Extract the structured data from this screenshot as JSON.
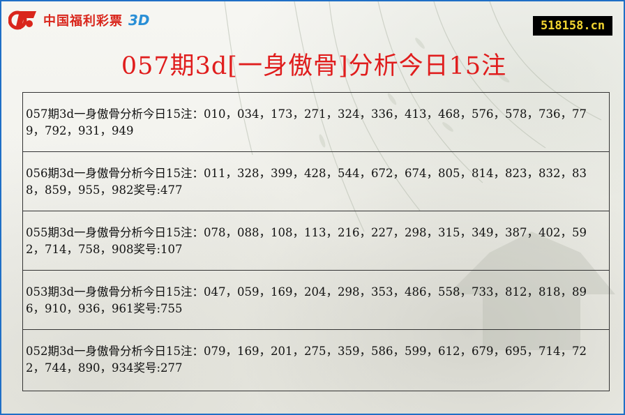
{
  "logo": {
    "name": "中国福利彩票",
    "suffix": "3D"
  },
  "site_badge": "518158.cn",
  "page_title": "057期3d[一身傲骨]分析今日15注",
  "rows": [
    {
      "text": "057期3d一身傲骨分析今日15注：010，034，173，271，324，336，413，468，576，578，736，779，792，931，949"
    },
    {
      "text": "056期3d一身傲骨分析今日15注：011，328，399，428，544，672，674，805，814，823，832，838，859，955，982奖号:477"
    },
    {
      "text": "055期3d一身傲骨分析今日15注：078，088，108，113，216，227，298，315，349，387，402，592，714，758，908奖号:107"
    },
    {
      "text": "053期3d一身傲骨分析今日15注：047，059，169，204，298，353，486，558，733，812，818，896，910，936，961奖号:755"
    },
    {
      "text": "052期3d一身傲骨分析今日15注：079，169，201，275，359，586，599，612，679，695，714，722，744，890，934奖号:277"
    }
  ],
  "colors": {
    "title": "#e01d1d",
    "frame_border": "#1f6fc6",
    "badge_bg": "#000000",
    "badge_text": "#f3d531",
    "logo_red": "#d9261c",
    "logo_blue": "#2a8fd6"
  }
}
